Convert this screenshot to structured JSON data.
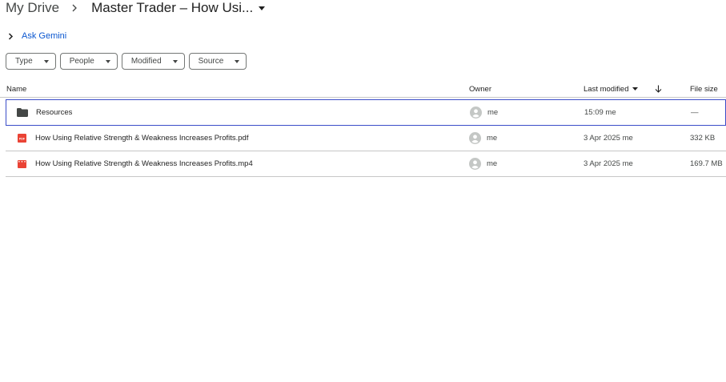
{
  "breadcrumb": {
    "root": "My Drive",
    "current": "Master Trader – How Usi..."
  },
  "gemini": {
    "label": "Ask Gemini"
  },
  "filters": [
    {
      "label": "Type"
    },
    {
      "label": "People"
    },
    {
      "label": "Modified"
    },
    {
      "label": "Source"
    }
  ],
  "columns": {
    "name": "Name",
    "owner": "Owner",
    "modified": "Last modified",
    "size": "File size"
  },
  "rows": [
    {
      "icon": "folder-icon",
      "name": "Resources",
      "owner": "me",
      "modified": "15:09 me",
      "size": "—",
      "selected": true
    },
    {
      "icon": "pdf-icon",
      "name": "How Using Relative Strength & Weakness Increases Profits.pdf",
      "owner": "me",
      "modified": "3 Apr 2025 me",
      "size": "332 KB"
    },
    {
      "icon": "video-icon",
      "name": "How Using Relative Strength & Weakness Increases Profits.mp4",
      "owner": "me",
      "modified": "3 Apr 2025 me",
      "size": "169.7 MB"
    }
  ],
  "colors": {
    "accent": "#0b57d0",
    "pdf": "#ea4335",
    "video": "#ea4335",
    "folder": "#444746",
    "selection": "#3b4dc8"
  }
}
